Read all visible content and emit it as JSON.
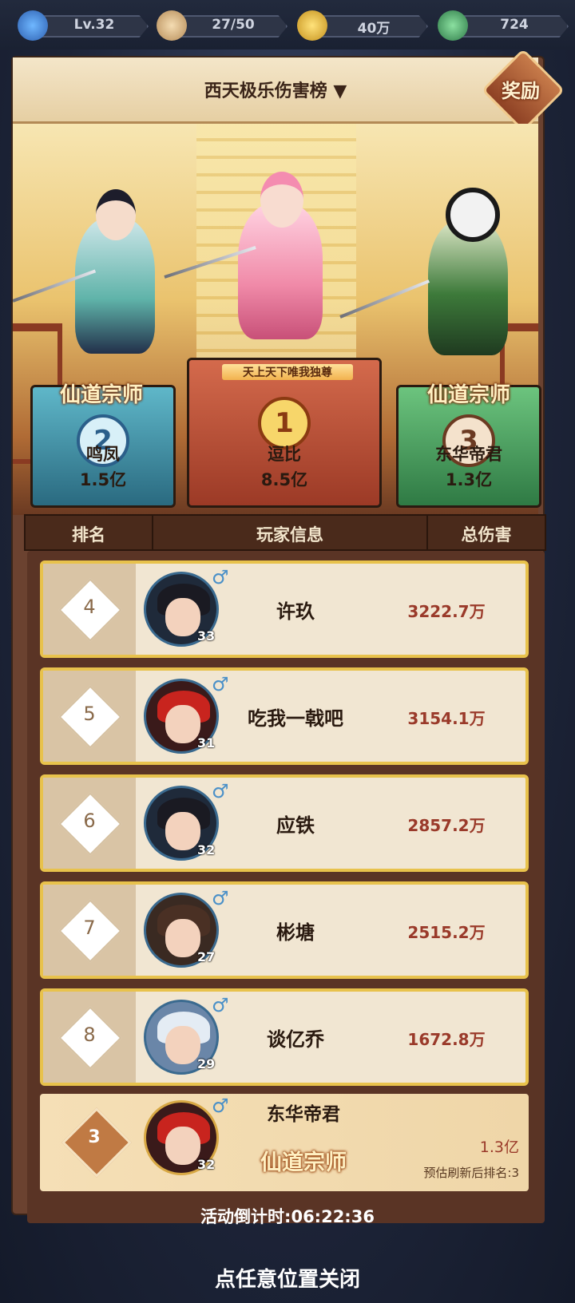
{
  "topbar": {
    "level": "Lv.32",
    "stamina": "27/50",
    "coins": "40万",
    "jade": "724"
  },
  "board": {
    "title": "西天极乐伤害榜 ▼",
    "reward_label": "奖励"
  },
  "podium": {
    "first": {
      "rank": "1",
      "name": "逗比",
      "value": "8.5亿",
      "title_tag": "天上天下唯我独尊"
    },
    "second": {
      "rank": "2",
      "name": "鸣凤",
      "value": "1.5亿",
      "banner": "仙道宗师"
    },
    "third": {
      "rank": "3",
      "name": "东华帝君",
      "value": "1.3亿",
      "banner": "仙道宗师"
    }
  },
  "table": {
    "headers": {
      "rank": "排名",
      "player": "玩家信息",
      "damage": "总伤害"
    },
    "rows": [
      {
        "rank": "4",
        "level": "33",
        "name": "许玖",
        "damage": "3222.7万"
      },
      {
        "rank": "5",
        "level": "31",
        "name": "吃我一戟吧",
        "damage": "3154.1万"
      },
      {
        "rank": "6",
        "level": "32",
        "name": "应铁",
        "damage": "2857.2万"
      },
      {
        "rank": "7",
        "level": "27",
        "name": "彬塘",
        "damage": "2515.2万"
      },
      {
        "rank": "8",
        "level": "29",
        "name": "谈亿乔",
        "damage": "1672.8万"
      }
    ]
  },
  "mine": {
    "rank": "3",
    "level": "32",
    "name": "东华帝君",
    "banner": "仙道宗师",
    "damage": "1.3亿",
    "estimate": "预估刷新后排名:3"
  },
  "countdown": "活动倒计时:06:22:36",
  "close_hint": "点任意位置关闭",
  "colors": {
    "accent_gold": "#e8c24c",
    "damage_red": "#9a3a2a",
    "second_teal": "#3b8fa6",
    "first_red": "#c2523a",
    "third_green": "#3f9a5a"
  }
}
